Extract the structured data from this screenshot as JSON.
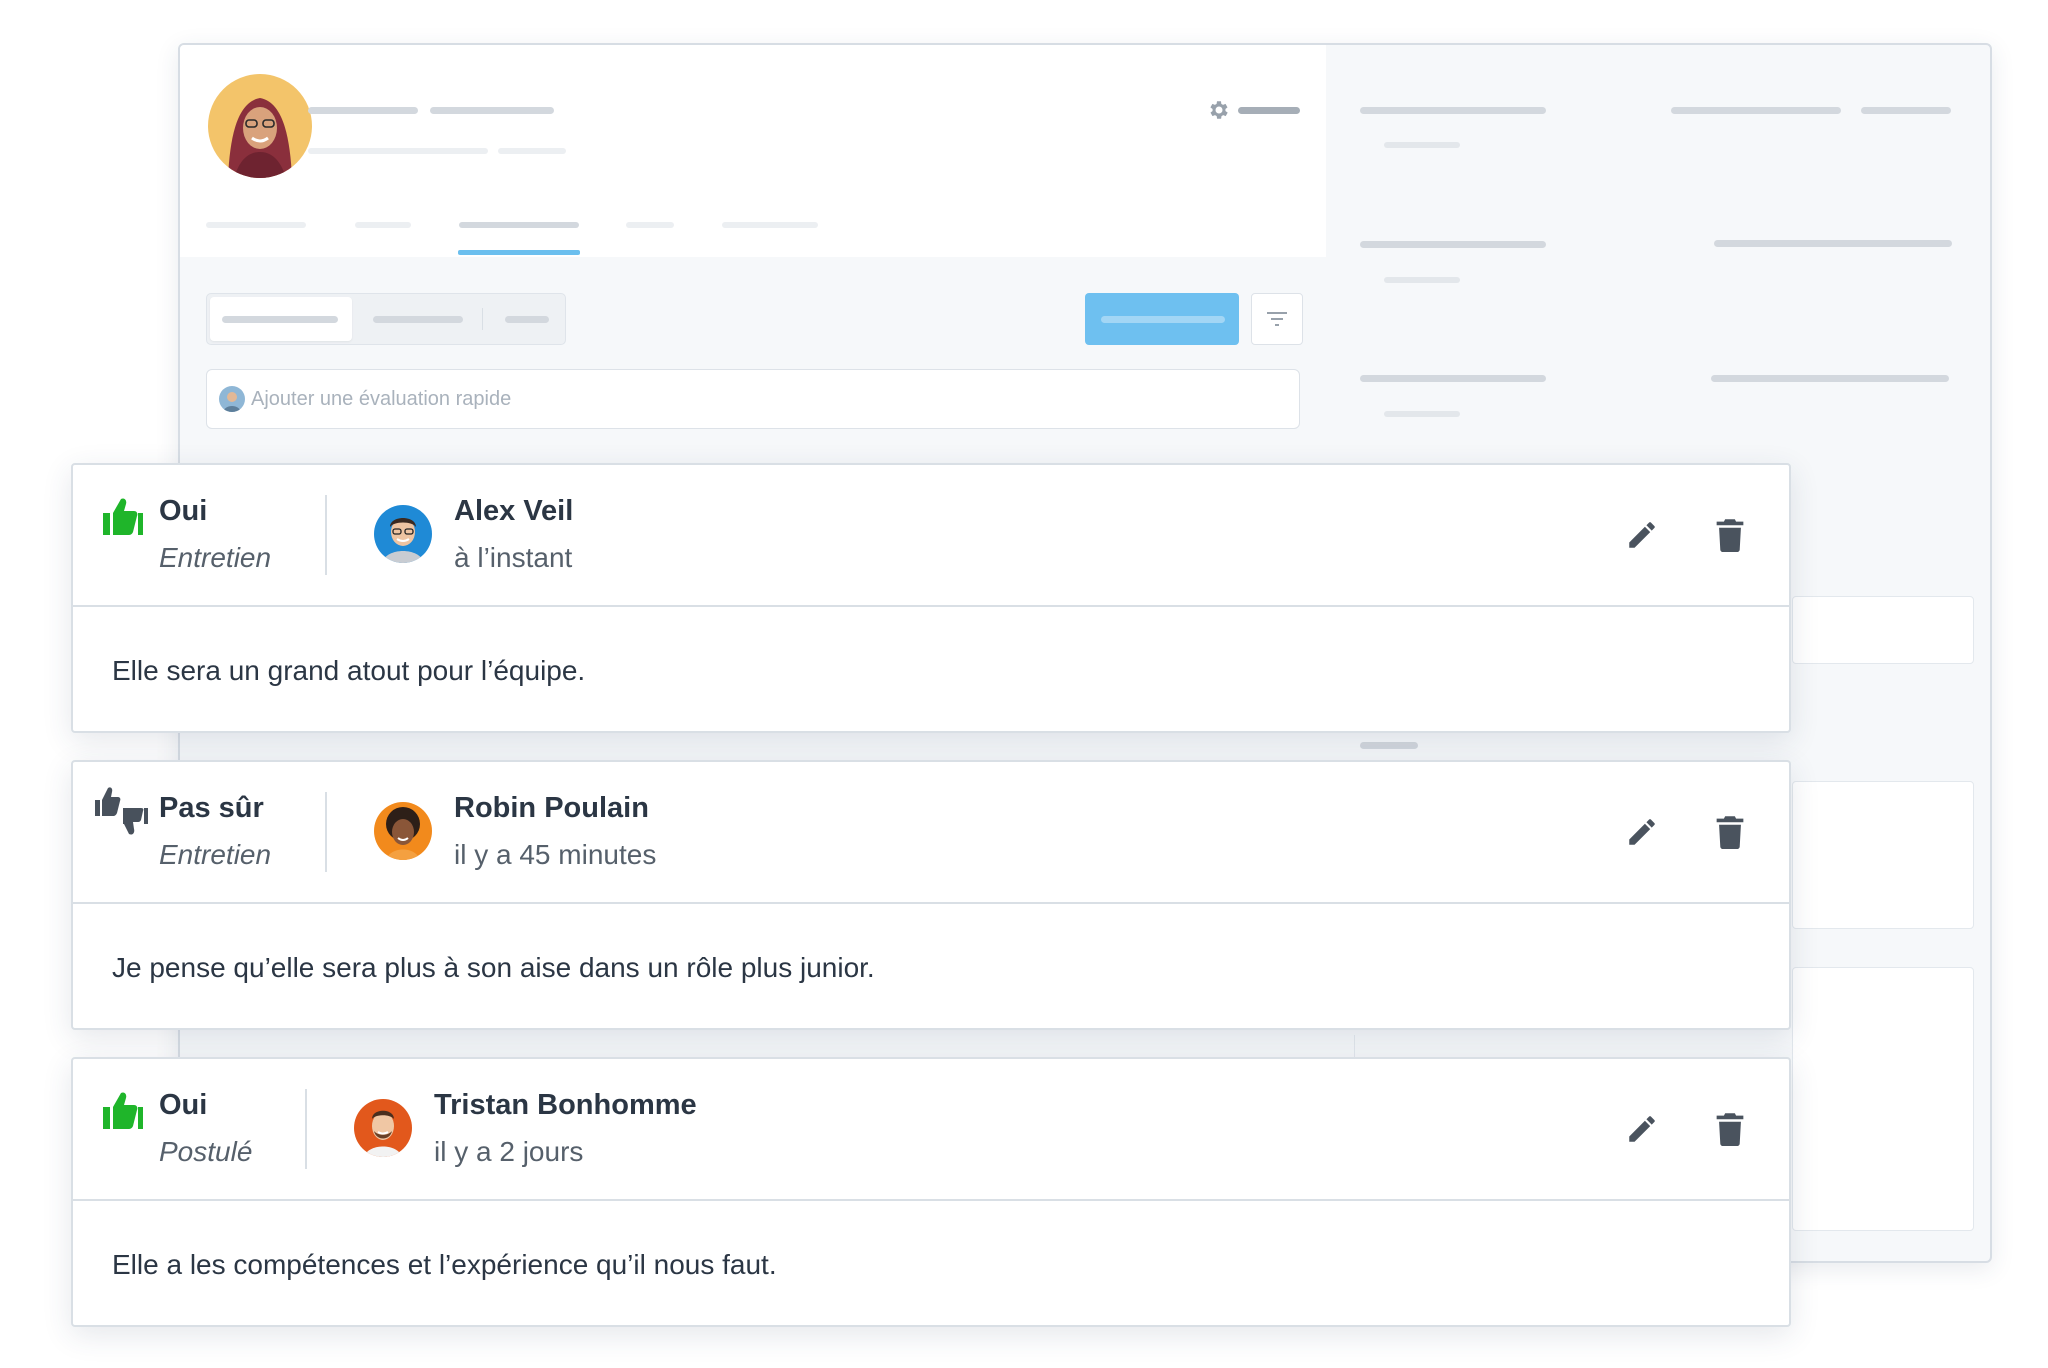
{
  "quick_eval": {
    "placeholder": "Ajouter une évaluation rapide"
  },
  "colors": {
    "accent": "#6ec0f0",
    "positive": "#1fb52a",
    "neutral": "#48515c"
  },
  "reviews": [
    {
      "verdict": "Oui",
      "verdict_icon": "thumbs-up-icon",
      "stage": "Entretien",
      "author": "Alex Veil",
      "time": "à l’instant",
      "comment": "Elle sera un grand atout pour l’équipe."
    },
    {
      "verdict": "Pas sûr",
      "verdict_icon": "thumbs-mixed-icon",
      "stage": "Entretien",
      "author": "Robin Poulain",
      "time": "il y a 45 minutes",
      "comment": "Je pense qu’elle sera plus à son aise dans un rôle plus junior."
    },
    {
      "verdict": "Oui",
      "verdict_icon": "thumbs-up-icon",
      "stage": "Postulé",
      "author": "Tristan Bonhomme",
      "time": "il y a 2 jours",
      "comment": "Elle a les compétences et l’expérience qu’il nous faut."
    }
  ]
}
